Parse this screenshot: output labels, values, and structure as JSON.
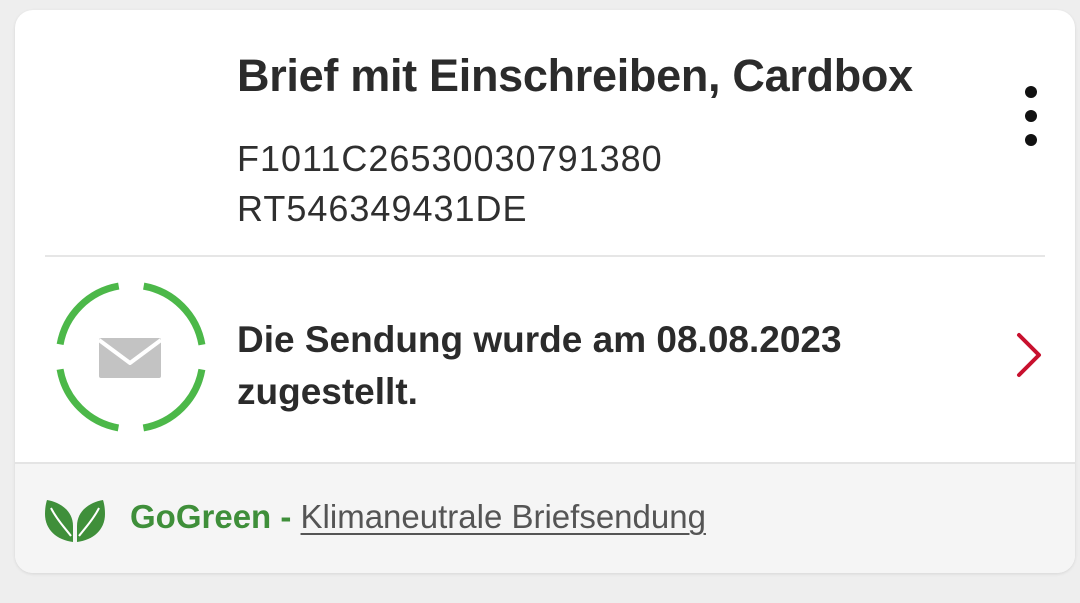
{
  "shipment": {
    "title": "Brief mit Einschreiben, Cardbox",
    "tracking_numbers": [
      "F1011C26530030791380",
      "RT546349431DE"
    ],
    "status_text": "Die Sendung wurde am 08.08.2023 zugestellt.",
    "status_color": "#4cb849",
    "chevron_color": "#c8102e"
  },
  "footer": {
    "brand": "GoGreen",
    "separator": " - ",
    "link_text": "Klimaneutrale Briefsendung",
    "brand_color": "#3f8f3a"
  },
  "icons": {
    "menu": "more-vertical-icon",
    "status": "envelope-icon",
    "chevron": "chevron-right-icon",
    "leaf": "leaf-icon"
  }
}
